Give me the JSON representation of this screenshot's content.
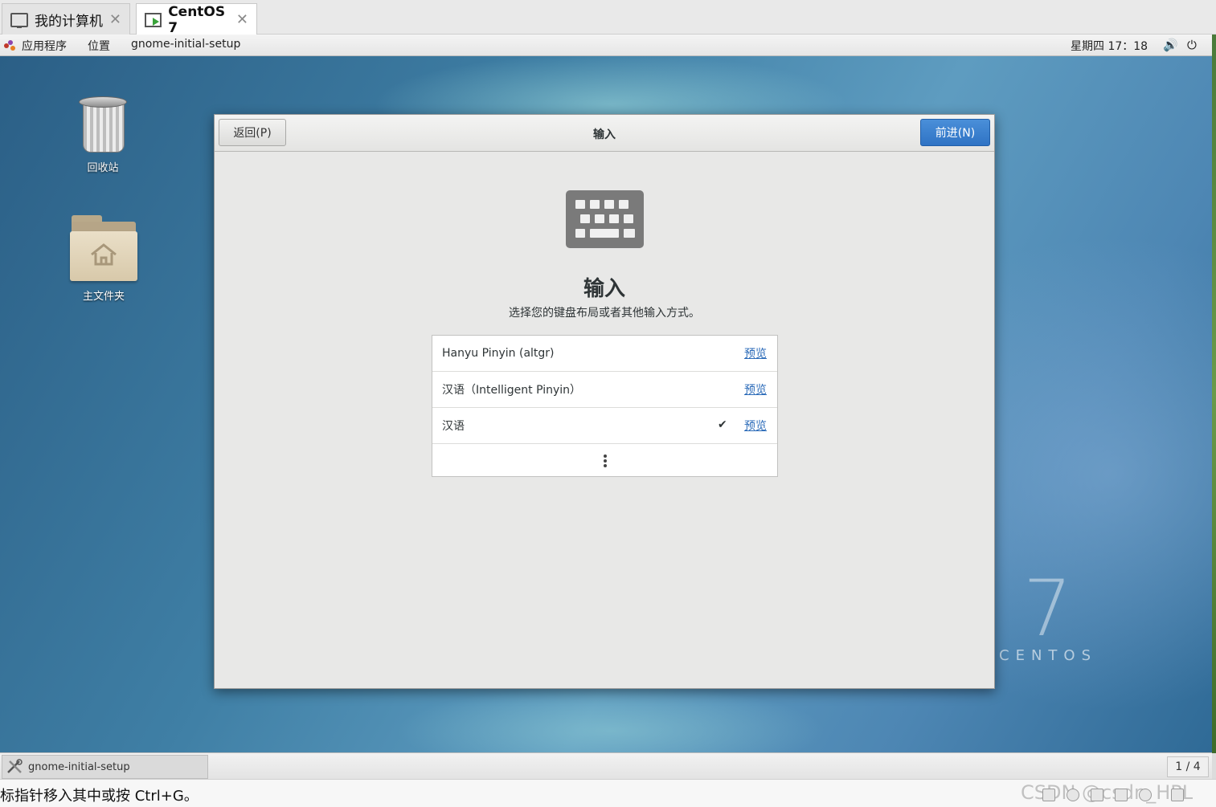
{
  "host": {
    "tabs": [
      {
        "label": "我的计算机",
        "icon": "monitor-icon"
      },
      {
        "label": "CentOS 7",
        "icon": "vm-running-icon"
      }
    ],
    "close_glyph": "✕",
    "status_hint": "标指针移入其中或按 Ctrl+G。",
    "watermark": "CSDN @csdn_HPL"
  },
  "topbar": {
    "applications": "应用程序",
    "places": "位置",
    "active_app": "gnome-initial-setup",
    "clock": "星期四 17：18",
    "volume_icon": "🔊",
    "power_icon": "⏻"
  },
  "desktop": {
    "icons": [
      {
        "label": "回收站",
        "icon": "trash-icon"
      },
      {
        "label": "主文件夹",
        "icon": "home-folder-icon"
      }
    ],
    "branding": {
      "number": "7",
      "word": "CENTOS"
    }
  },
  "setup": {
    "back_label": "返回(P)",
    "next_label": "前进(N)",
    "header_title": "输入",
    "page_title": "输入",
    "page_subtitle": "选择您的键盘布局或者其他输入方式。",
    "preview_label": "预览",
    "check_glyph": "✔",
    "sources": [
      {
        "name": "Hanyu Pinyin (altgr)",
        "selected": false
      },
      {
        "name": "汉语（Intelligent Pinyin）",
        "selected": false
      },
      {
        "name": "汉语",
        "selected": true
      }
    ]
  },
  "taskbar": {
    "task_label": "gnome-initial-setup",
    "workspace": "1 / 4"
  }
}
